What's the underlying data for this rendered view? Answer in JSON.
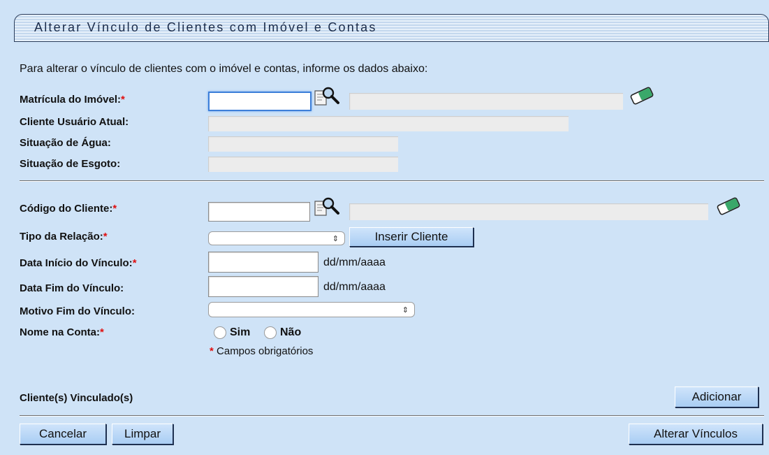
{
  "title": "Alterar Vínculo de Clientes com Imóvel e Contas",
  "intro": "Para alterar o vínculo de clientes com o imóvel e contas, informe os dados abaixo:",
  "labels": {
    "matricula": "Matrícula do Imóvel:",
    "cliente_usuario": "Cliente Usuário Atual:",
    "situacao_agua": "Situação de Água:",
    "situacao_esgoto": "Situação de Esgoto:",
    "codigo_cliente": "Código do Cliente:",
    "tipo_relacao": "Tipo da Relação:",
    "data_inicio": "Data Início do Vínculo:",
    "data_fim": "Data Fim do Vínculo:",
    "motivo_fim": "Motivo Fim do Vínculo:",
    "nome_conta": "Nome na Conta:",
    "clientes_vinculados": "Cliente(s) Vinculado(s)"
  },
  "required_mark": "*",
  "values": {
    "matricula": "",
    "cliente_usuario": "",
    "situacao_agua": "",
    "situacao_esgoto": "",
    "codigo_cliente": "",
    "data_inicio": "",
    "data_fim": ""
  },
  "date_hint": "dd/mm/aaaa",
  "radio_options": {
    "sim": "Sim",
    "nao": "Não"
  },
  "required_note": "Campos obrigatórios",
  "buttons": {
    "inserir_cliente": "Inserir Cliente",
    "adicionar": "Adicionar",
    "cancelar": "Cancelar",
    "limpar": "Limpar",
    "alterar_vinculos": "Alterar Vínculos"
  },
  "icons": {
    "search": "magnifier-icon",
    "clear": "eraser-icon",
    "select_arrow": "⇕"
  },
  "colors": {
    "background": "#cfe3f7",
    "required": "#e01010",
    "button": "#a9cdf3"
  }
}
